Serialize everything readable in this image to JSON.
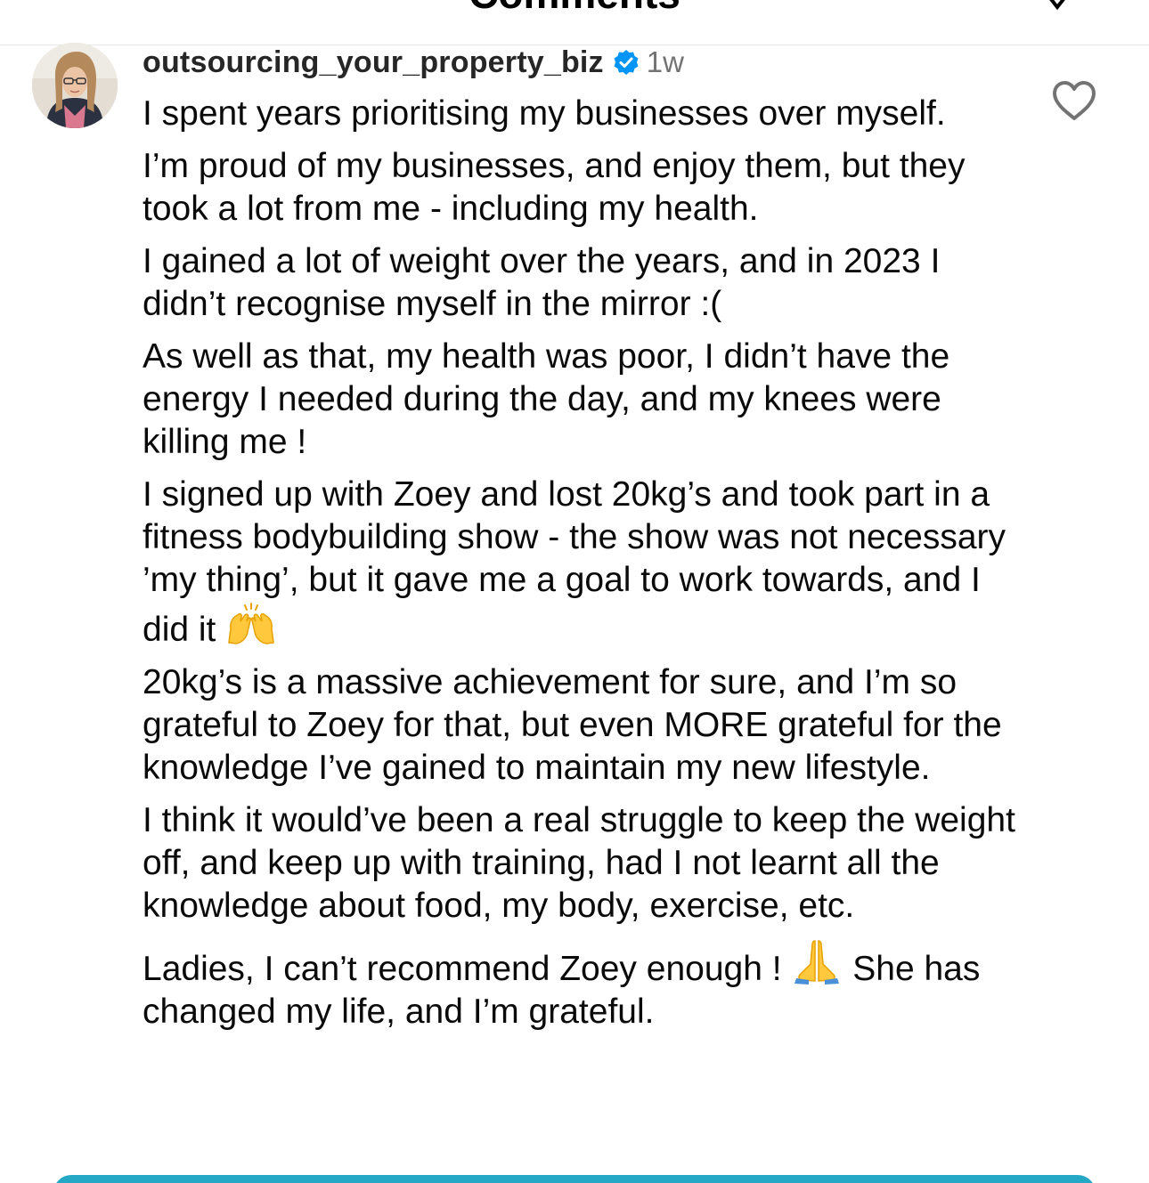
{
  "header": {
    "title": "Comments"
  },
  "comment": {
    "username": "outsourcing_your_property_biz",
    "time": "1w",
    "paragraphs": [
      "I spent years prioritising my businesses over myself.",
      "I’m proud of my businesses, and enjoy them, but they took a lot from me - including my health.",
      "I gained a lot of weight over the years, and in 2023 I didn’t recognise myself in the mirror :(",
      "As well as that, my health was poor, I didn’t have the energy I needed during the day, and my knees were killing me !",
      "I signed up with Zoey and lost 20kg’s and took part in a fitness bodybuilding show - the show was not necessary ’my thing’, but it gave me a goal to work towards, and I did it",
      "20kg’s is a massive achievement for sure, and I’m so grateful to Zoey for that, but even MORE grateful for the knowledge I’ve gained to maintain my new lifestyle.",
      "I think it would’ve been a real struggle to keep the weight off, and keep up with training, had I not learnt all the knowledge about food, my body, exercise, etc.",
      "Ladies, I can’t recommend Zoey enough !",
      "She has changed my life, and I’m grateful."
    ]
  },
  "icons": {
    "avatar": "avatar",
    "verified": "verified-badge-icon",
    "heart": "heart-outline-icon",
    "raised_hands": "raising-hands-emoji",
    "pray": "folded-hands-emoji"
  },
  "colors": {
    "verified": "#0095f6",
    "bottom_bar": "#25a8c6"
  }
}
